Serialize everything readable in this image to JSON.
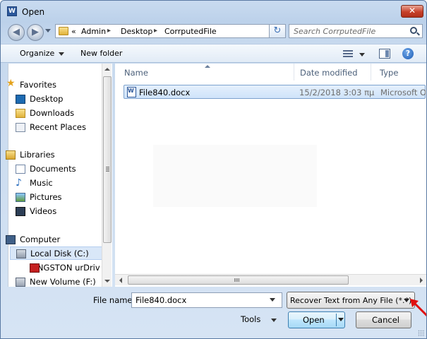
{
  "window": {
    "title": "Open",
    "app_icon_letter": "W"
  },
  "nav": {
    "breadcrumb": [
      "Admin",
      "Desktop",
      "CorrputedFile"
    ],
    "overflow_marker": "«",
    "separator": "▸",
    "search_placeholder": "Search CorrputedFile"
  },
  "toolbar": {
    "organize_label": "Organize",
    "new_folder_label": "New folder"
  },
  "sidebar": {
    "favorites": {
      "label": "Favorites",
      "items": [
        "Desktop",
        "Downloads",
        "Recent Places"
      ]
    },
    "libraries": {
      "label": "Libraries",
      "items": [
        "Documents",
        "Music",
        "Pictures",
        "Videos"
      ]
    },
    "computer": {
      "label": "Computer",
      "items": [
        "Local Disk (C:)",
        "KINGSTON urDrive",
        "New Volume (F:)"
      ],
      "selected": "Local Disk (C:)"
    }
  },
  "files": {
    "columns": [
      "Name",
      "Date modified",
      "Type"
    ],
    "rows": [
      {
        "name": "File840.docx",
        "date": "15/2/2018 3:03 πμ",
        "type": "Microsoft Office Word Document"
      }
    ]
  },
  "footer": {
    "file_name_label": "File name:",
    "file_name_value": "File840.docx",
    "file_type": "Recover Text from Any File (*.*)",
    "tools_label": "Tools",
    "open_label": "Open",
    "cancel_label": "Cancel"
  },
  "colors": {
    "annotation_arrow": "#e01010",
    "selection": "#cfe3fa"
  },
  "icons": {
    "close": "close-icon",
    "back": "back-arrow-icon",
    "forward": "forward-arrow-icon",
    "refresh": "refresh-icon",
    "search": "search-icon",
    "help": "help-icon"
  }
}
